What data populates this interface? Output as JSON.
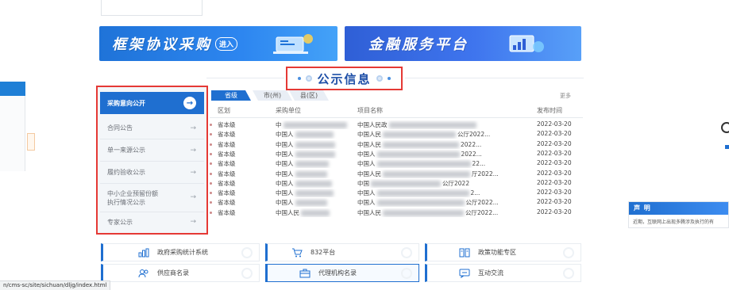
{
  "banners": {
    "left_title": "框架协议采购",
    "left_enter": "进入",
    "right_title": "金融服务平台"
  },
  "section": {
    "title": "公示信息"
  },
  "menu": {
    "items": [
      {
        "label": "采购意向公开",
        "active": true
      },
      {
        "label": "合同公告"
      },
      {
        "label": "单一来源公示"
      },
      {
        "label": "履约验收公示"
      },
      {
        "label": "中小企业预留份额\n执行情况公示"
      },
      {
        "label": "专家公示"
      }
    ],
    "arrow": "→"
  },
  "tabs": [
    "省级",
    "市(州)",
    "县(区)"
  ],
  "more": "更多",
  "table": {
    "headers": [
      "区划",
      "采购单位",
      "项目名称",
      "发布时间"
    ],
    "rows": [
      {
        "region": "省本级",
        "unit": "中",
        "project": "中国人民政",
        "project_tail": "",
        "date": "2022-03-20"
      },
      {
        "region": "省本级",
        "unit": "中国人",
        "project": "中国人民",
        "project_tail": "公厅2022...",
        "date": "2022-03-20"
      },
      {
        "region": "省本级",
        "unit": "中国人",
        "project": "中国人民",
        "project_tail": "2022...",
        "date": "2022-03-20"
      },
      {
        "region": "省本级",
        "unit": "中国人",
        "project": "中国人",
        "project_tail": "2022...",
        "date": "2022-03-20"
      },
      {
        "region": "省本级",
        "unit": "中国人",
        "project": "中国人",
        "project_tail": "22...",
        "date": "2022-03-20"
      },
      {
        "region": "省本级",
        "unit": "中国人",
        "project": "中国人民",
        "project_tail": "厅2022...",
        "date": "2022-03-20"
      },
      {
        "region": "省本级",
        "unit": "中国人",
        "project": "中国",
        "project_tail": "公厅2022",
        "date": "2022-03-20"
      },
      {
        "region": "省本级",
        "unit": "中国人",
        "project": "中国人",
        "project_tail": "2...",
        "date": "2022-03-20"
      },
      {
        "region": "省本级",
        "unit": "中国人",
        "project": "中国人",
        "project_tail": "公厅2022...",
        "date": "2022-03-20"
      },
      {
        "region": "省本级",
        "unit": "中国人民",
        "project": "中国人民",
        "project_tail": "公厅2022...",
        "date": "2022-03-20"
      }
    ]
  },
  "quicklinks": [
    {
      "label": "政府采购统计系统",
      "icon": "bar-chart-icon"
    },
    {
      "label": "832平台",
      "icon": "cart-icon"
    },
    {
      "label": "政策功能专区",
      "icon": "book-icon"
    },
    {
      "label": "供应商名录",
      "icon": "users-icon"
    },
    {
      "label": "代理机构名录",
      "icon": "briefcase-icon"
    },
    {
      "label": "互动交流",
      "icon": "chat-icon"
    }
  ],
  "statusbar": {
    "url": "n/cms-sc/site/sichuan/dljg/index.html"
  },
  "declaration": {
    "title": "声 明",
    "body": "近期，互联网上出现多腾涉及执行的有"
  },
  "colors": {
    "primary": "#1f6fd0",
    "highlight_border": "#e53935",
    "title_text": "#1e4fa7"
  }
}
